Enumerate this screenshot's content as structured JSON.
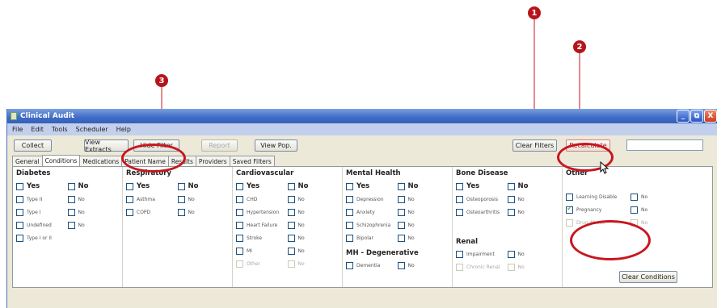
{
  "window": {
    "title": "Clinical Audit",
    "controls": [
      "_",
      "⧉",
      "X"
    ]
  },
  "menu": [
    "File",
    "Edit",
    "Tools",
    "Scheduler",
    "Help"
  ],
  "toolbar": {
    "collect": "Collect",
    "view_extracts": "View Extracts",
    "hide_filter": "Hide Filter",
    "report": "Report",
    "view_pop": "View Pop.",
    "clear_filters": "Clear Filters",
    "recalculate": "Recalculate"
  },
  "tabs": [
    "General",
    "Conditions",
    "Medications",
    "Patient Name",
    "Results",
    "Providers",
    "Saved Filters"
  ],
  "columns": {
    "diabetes": {
      "title": "Diabetes",
      "yes": "Yes",
      "no": "No",
      "items": [
        {
          "label": "Type II",
          "no": "No"
        },
        {
          "label": "Type I",
          "no": "No"
        },
        {
          "label": "Undefined",
          "no": "No"
        },
        {
          "label": "Type I or II"
        }
      ]
    },
    "respiratory": {
      "title": "Respiratory",
      "yes": "Yes",
      "no": "No",
      "items": [
        {
          "label": "Asthma",
          "no": "No"
        },
        {
          "label": "COPD",
          "no": "No"
        }
      ]
    },
    "cardiovascular": {
      "title": "Cardiovascular",
      "yes": "Yes",
      "no": "No",
      "items": [
        {
          "label": "CHD",
          "no": "No"
        },
        {
          "label": "Hypertension",
          "no": "No"
        },
        {
          "label": "Heart Failure",
          "no": "No"
        },
        {
          "label": "Stroke",
          "no": "No"
        },
        {
          "label": "MI",
          "no": "No"
        },
        {
          "label": "Other",
          "no": "No"
        }
      ]
    },
    "mental_health": {
      "title": "Mental Health",
      "yes": "Yes",
      "no": "No",
      "items": [
        {
          "label": "Depression",
          "no": "No"
        },
        {
          "label": "Anxiety",
          "no": "No"
        },
        {
          "label": "Schizophrenia",
          "no": "No"
        },
        {
          "label": "Bipolar",
          "no": "No"
        }
      ],
      "sub_title": "MH - Degenerative",
      "sub_items": [
        {
          "label": "Dementia",
          "no": "No"
        }
      ]
    },
    "bone_disease": {
      "title": "Bone Disease",
      "yes": "Yes",
      "no": "No",
      "items": [
        {
          "label": "Osteoporosis",
          "no": "No"
        },
        {
          "label": "Osteoarthritis",
          "no": "No"
        }
      ],
      "sub_title": "Renal",
      "sub_items": [
        {
          "label": "Impairment",
          "no": "No"
        },
        {
          "label": "Chronic Renal",
          "no": "No"
        }
      ]
    },
    "other": {
      "title": "Other",
      "items": [
        {
          "label": "Learning Disable",
          "no": "No"
        },
        {
          "label": "Pregnancy",
          "no": "No",
          "checked": true
        },
        {
          "label": "Drug Abuse",
          "no": "No"
        }
      ],
      "clear_conditions": "Clear Conditions"
    }
  },
  "callouts": [
    "1",
    "2",
    "3"
  ]
}
